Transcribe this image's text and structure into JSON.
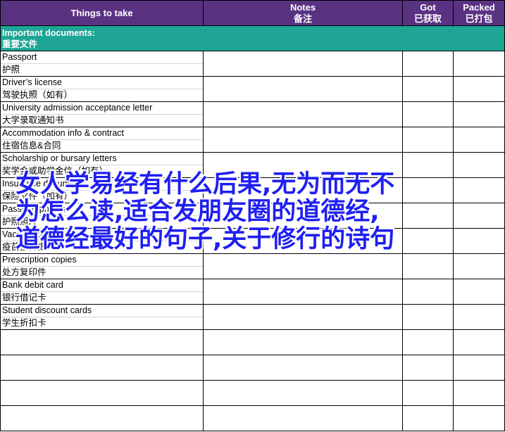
{
  "header": {
    "things_label": "Things to take",
    "notes_en": "Notes",
    "notes_zh": "备注",
    "got_en": "Got",
    "got_zh": "已获取",
    "packed_en": "Packed",
    "packed_zh": "已打包"
  },
  "section": {
    "title_en": "Important documents:",
    "title_zh": "重要文件"
  },
  "items": [
    {
      "en": "Passport",
      "zh": "护照"
    },
    {
      "en": "Driver’s license",
      "zh": "驾驶执照（如有）"
    },
    {
      "en": "University admission acceptance letter",
      "zh": "大学录取通知书"
    },
    {
      "en": "Accommodation info & contract",
      "zh": "住宿信息&合同"
    },
    {
      "en": "Scholarship or bursary letters",
      "zh": "奖学金或助学金信（如有）"
    },
    {
      "en": "Insurance documents",
      "zh": "保险文件（如有）"
    },
    {
      "en": "Passport photos",
      "zh": "护照照片"
    },
    {
      "en": "Vaccination history",
      "zh": "疫苗接种史"
    },
    {
      "en": "Prescription copies",
      "zh": "处方复印件"
    },
    {
      "en": "Bank debit card",
      "zh": "银行借记卡"
    },
    {
      "en": "Student discount cards",
      "zh": "学生折扣卡"
    }
  ],
  "overlay": {
    "line1": "女人学易经有什么后果,无为而无不",
    "line2": "为怎么读,适合发朋友圈的道德经,",
    "line3": "道德经最好的句子,关于修行的诗句",
    "color": "#1f1ff2"
  },
  "colors": {
    "header_bg": "#5a3282",
    "section_bg": "#1ea596"
  }
}
